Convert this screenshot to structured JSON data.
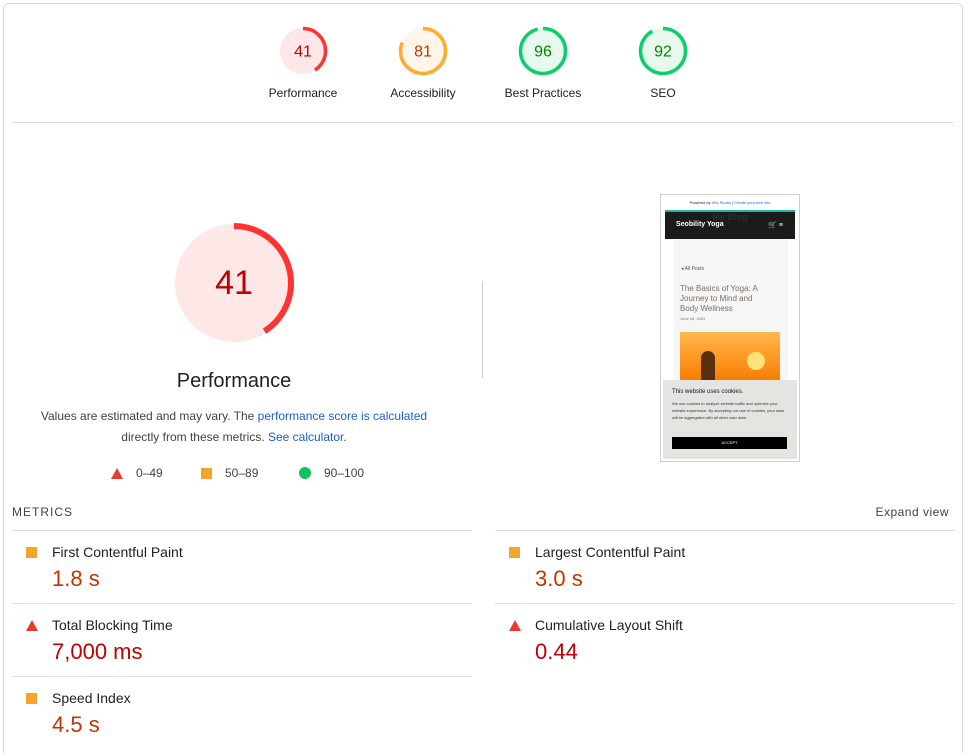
{
  "category_scores": [
    {
      "score": "41",
      "label": "Performance",
      "value": 41,
      "rating": "fail",
      "color": "#ff3333",
      "bg": "#fde8e7",
      "text_color": "#c00000"
    },
    {
      "score": "81",
      "label": "Accessibility",
      "value": 81,
      "rating": "average",
      "color": "#ffaa33",
      "bg": "#fff5e8",
      "text_color": "#c33300"
    },
    {
      "score": "96",
      "label": "Best Practices",
      "value": 96,
      "rating": "pass",
      "color": "#0cce6b",
      "bg": "#e7f8ee",
      "text_color": "#008800"
    },
    {
      "score": "92",
      "label": "SEO",
      "value": 92,
      "rating": "pass",
      "color": "#0cce6b",
      "bg": "#e7f8ee",
      "text_color": "#008800"
    }
  ],
  "performance": {
    "score": "41",
    "value": 41,
    "title": "Performance",
    "desc_part1": "Values are estimated and may vary. The ",
    "desc_link1": "performance score is calculated",
    "desc_part2": " directly from these metrics. ",
    "desc_link2": "See calculator",
    "desc_part3": "."
  },
  "legend": [
    {
      "icon": "triangle-icon",
      "range": "0–49"
    },
    {
      "icon": "square-icon",
      "range": "50–89"
    },
    {
      "icon": "circle-icon",
      "range": "90–100"
    }
  ],
  "screenshot": {
    "powered_by": "Powered by ",
    "wix": "Wix Studio",
    "create_site": "Create your free site",
    "blog_name": "My Blog",
    "brand": "Seobility Yoga",
    "header_icons": "🛒 ≡",
    "all_posts": "◂ All Posts",
    "post_title": "The Basics of Yoga: A Journey to Mind and Body Wellness",
    "post_date": "June 28, 2024",
    "cookie_title": "This website uses cookies.",
    "cookie_text": "We use cookies to analyze website traffic and optimize your website experience. By accepting our use of cookies, your data will be aggregated with all other user data.",
    "accept": "ACCEPT"
  },
  "metrics": {
    "heading": "METRICS",
    "expand": "Expand view",
    "items": [
      {
        "name": "First Contentful Paint",
        "value": "1.8 s",
        "rating": "average"
      },
      {
        "name": "Largest Contentful Paint",
        "value": "3.0 s",
        "rating": "average"
      },
      {
        "name": "Total Blocking Time",
        "value": "7,000 ms",
        "rating": "fail"
      },
      {
        "name": "Cumulative Layout Shift",
        "value": "0.44",
        "rating": "fail"
      },
      {
        "name": "Speed Index",
        "value": "4.5 s",
        "rating": "average"
      }
    ]
  }
}
